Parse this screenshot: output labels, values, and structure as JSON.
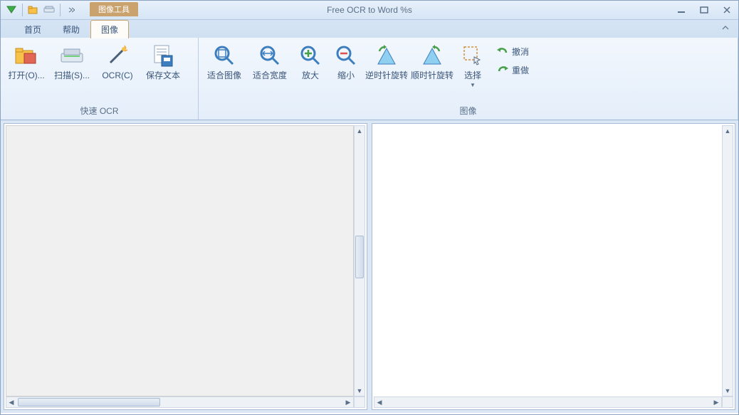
{
  "window": {
    "title": "Free OCR to Word %s",
    "contextual_tab_title": "图像工具"
  },
  "tabs": {
    "home": "首页",
    "help": "帮助",
    "image": "图像"
  },
  "ribbon": {
    "groups": {
      "quick_ocr": {
        "title": "快速 OCR"
      },
      "image": {
        "title": "图像"
      }
    },
    "buttons": {
      "open": "打开(O)...",
      "scan": "扫描(S)...",
      "ocr": "OCR(C)",
      "save_text": "保存文本",
      "fit_image": "适合图像",
      "fit_width": "适合宽度",
      "zoom_in": "放大",
      "zoom_out": "缩小",
      "rotate_ccw": "逆时针旋转",
      "rotate_cw": "顺时针旋转",
      "select": "选择",
      "undo": "撤消",
      "redo": "重做"
    }
  }
}
